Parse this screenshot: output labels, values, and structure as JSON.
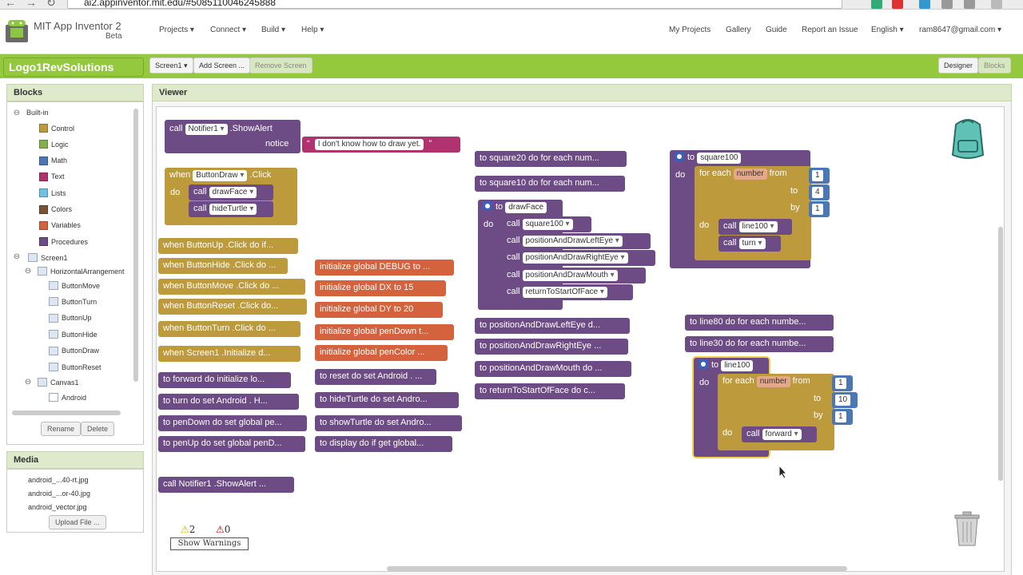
{
  "browser": {
    "url": "ai2.appinventor.mit.edu/#5085110046245888"
  },
  "header": {
    "title": "MIT App Inventor 2",
    "subtitle": "Beta",
    "menus": [
      "Projects",
      "Connect",
      "Build",
      "Help"
    ],
    "links": [
      "My Projects",
      "Gallery",
      "Guide",
      "Report an Issue"
    ],
    "language": "English",
    "account": "ram8647@gmail.com"
  },
  "toolbar": {
    "project": "Logo1RevSolutions",
    "screen": "Screen1",
    "add_screen": "Add Screen ...",
    "remove_screen": "Remove Screen",
    "designer": "Designer",
    "blocks": "Blocks"
  },
  "blocks_panel": {
    "title": "Blocks",
    "builtin": "Built-in",
    "builtin_items": [
      {
        "label": "Control",
        "color": "#bd9a3c"
      },
      {
        "label": "Logic",
        "color": "#84b04c"
      },
      {
        "label": "Math",
        "color": "#4b78b5"
      },
      {
        "label": "Text",
        "color": "#b0326e"
      },
      {
        "label": "Lists",
        "color": "#6ec1e4"
      },
      {
        "label": "Colors",
        "color": "#7a5233"
      },
      {
        "label": "Variables",
        "color": "#d4623c"
      },
      {
        "label": "Procedures",
        "color": "#6d4b85"
      }
    ],
    "screen": "Screen1",
    "arrangement": "HorizontalArrangement",
    "arr_children": [
      "ButtonMove",
      "ButtonTurn",
      "ButtonUp",
      "ButtonHide",
      "ButtonDraw",
      "ButtonReset"
    ],
    "canvas": "Canvas1",
    "canvas_children": [
      "Android"
    ],
    "rename": "Rename",
    "delete": "Delete"
  },
  "media": {
    "title": "Media",
    "files": [
      "android_...40-rt.jpg",
      "android_...or-40.jpg",
      "android_vector.jpg"
    ],
    "upload": "Upload File ..."
  },
  "viewer": {
    "title": "Viewer",
    "warnings": "2",
    "errors": "0",
    "show_warnings": "Show Warnings"
  },
  "blocks": {
    "alert": {
      "call": "call",
      "comp": "Notifier1",
      "method": ".ShowAlert",
      "notice": "notice",
      "text": "I don't know how to draw yet."
    },
    "when_draw": {
      "when": "when",
      "comp": "ButtonDraw",
      "event": ".Click",
      "do": "do",
      "c1": "drawFace",
      "c2": "hideTurtle",
      "call": "call"
    },
    "col1": [
      "when ButtonUp .Click do if...",
      "when ButtonHide .Click do ...",
      "when ButtonMove .Click do ...",
      "when ButtonReset .Click do...",
      "when ButtonTurn .Click do ...",
      "when Screen1 .Initialize d...",
      "to forward do initialize lo...",
      "to turn do set Android . H...",
      "to penDown do set global pe...",
      "to penUp do set global penD...",
      "call Notifier1 .ShowAlert ..."
    ],
    "col2": [
      "initialize global DEBUG to ...",
      "initialize global DX to 15",
      "initialize global DY to 20",
      "initialize global penDown t...",
      "initialize global penColor ...",
      "to reset do set Android . ...",
      "to hideTurtle do set Andro...",
      "to showTurtle do set Andro...",
      "to display do if get global..."
    ],
    "col3": [
      "to square20 do for each num...",
      "to square10 do for each num...",
      "to positionAndDrawLeftEye d...",
      "to positionAndDrawRightEye ...",
      "to positionAndDrawMouth do ...",
      "to returnToStartOfFace do c..."
    ],
    "drawface": {
      "to": "to",
      "name": "drawFace",
      "do": "do",
      "call": "call",
      "calls": [
        "square100",
        "positionAndDrawLeftEye",
        "positionAndDrawRightEye",
        "positionAndDrawMouth",
        "returnToStartOfFace"
      ]
    },
    "square100": {
      "to": "to",
      "name": "square100",
      "do": "do",
      "foreach": "for each",
      "var": "number",
      "from": "from",
      "to_lbl": "to",
      "by": "by",
      "from_v": "1",
      "to_v": "4",
      "by_v": "1",
      "call": "call",
      "c1": "line100",
      "c2": "turn"
    },
    "col4": [
      "to line80 do for each numbe...",
      "to line30 do for each numbe..."
    ],
    "line100": {
      "to": "to",
      "name": "line100",
      "do": "do",
      "foreach": "for each",
      "var": "number",
      "from": "from",
      "to_lbl": "to",
      "by": "by",
      "from_v": "1",
      "to_v": "10",
      "by_v": "1",
      "call": "call",
      "c1": "forward"
    }
  }
}
